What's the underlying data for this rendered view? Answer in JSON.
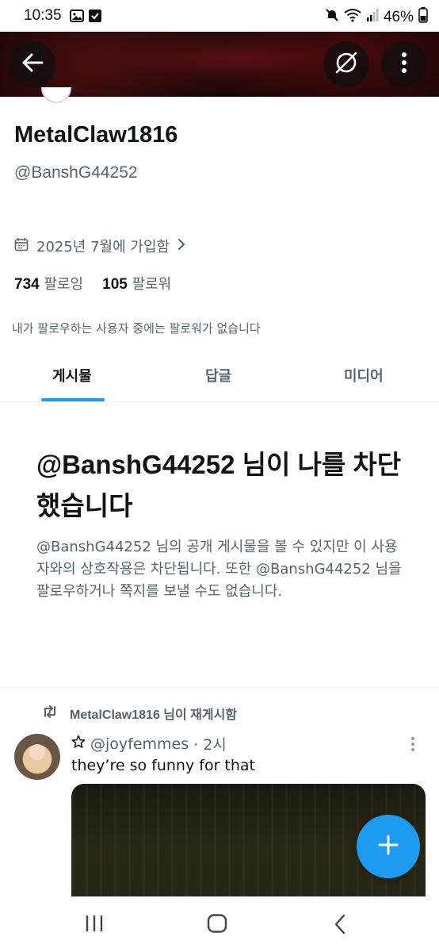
{
  "status_bar": {
    "time": "10:35",
    "battery": "46%",
    "icons": [
      "gallery-icon",
      "checkbox-icon",
      "mute-icon",
      "wifi-icon",
      "signal-icon",
      "battery-icon"
    ]
  },
  "header": {
    "back_icon": "arrow-left-icon",
    "grok_icon": "slash-circle-icon",
    "more_icon": "vertical-dots-icon"
  },
  "profile": {
    "display_name": "MetalClaw1816",
    "handle": "@BanshG44252",
    "joined": "2025년 7월에 가입함",
    "following_count": "734",
    "following_label": "팔로잉",
    "followers_count": "105",
    "followers_label": "팔로워",
    "mutual_note": "내가 팔로우하는 사용자 중에는 팔로워가 없습니다"
  },
  "tabs": [
    {
      "label": "게시물",
      "active": true
    },
    {
      "label": "답글",
      "active": false
    },
    {
      "label": "미디어",
      "active": false
    }
  ],
  "blocked": {
    "title": "@BanshG44252 님이 나를 차단했습니다",
    "description": "@BanshG44252 님의 공개 게시물을 볼 수 있지만 이 사용자와의 상호작용은 차단됩니다. 또한 @BanshG44252 님을 팔로우하거나 쪽지를 보낼 수도 없습니다."
  },
  "post": {
    "repost_label": "MetalClaw1816 님이 재게시함",
    "author_handle": "@joyfemmes",
    "time": "· 2시",
    "text": "they’re so funny for that"
  },
  "colors": {
    "accent": "#1d9bf0",
    "secondary_text": "#536471",
    "primary_text": "#0f1419"
  }
}
